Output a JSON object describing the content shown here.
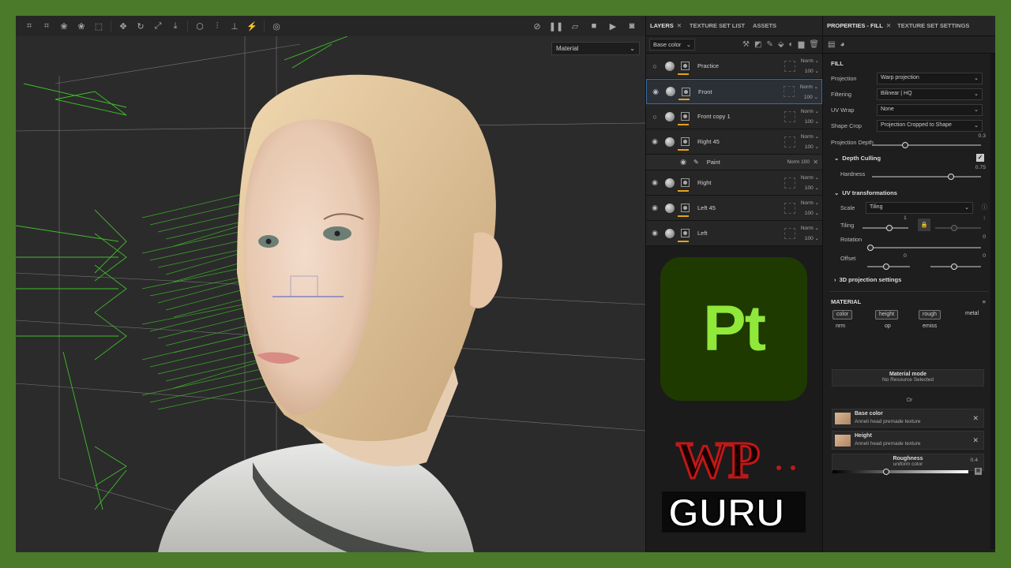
{
  "viewport": {
    "material_select": "Material",
    "toolbar_left": [
      "crop-icon",
      "crop-alt-icon",
      "brush-icon",
      "clone-icon",
      "select-icon",
      "move-icon",
      "rotate-icon",
      "scale-icon",
      "import-icon",
      "cube-icon",
      "mirror-icon",
      "align-icon",
      "magic-icon",
      "camera-reset-icon"
    ],
    "toolbar_right": [
      "hide-icon",
      "pause-icon",
      "view-icon",
      "render-icon",
      "record-icon",
      "screenshot-icon"
    ]
  },
  "layers_panel": {
    "tabs": [
      "LAYERS",
      "TEXTURE SET LIST",
      "ASSETS"
    ],
    "channel": "Base color",
    "layers": [
      {
        "name": "Practice",
        "visible": false,
        "blend": "Norm",
        "opacity": "100"
      },
      {
        "name": "Front",
        "visible": true,
        "blend": "Norm",
        "opacity": "100",
        "selected": true
      },
      {
        "name": "Front copy 1",
        "visible": false,
        "blend": "Norm",
        "opacity": "100"
      },
      {
        "name": "Right 45",
        "visible": true,
        "blend": "Norm",
        "opacity": "100"
      },
      {
        "name": "Paint",
        "visible": true,
        "blend": "Norm",
        "opacity": "100",
        "sub": true
      },
      {
        "name": "Right",
        "visible": true,
        "blend": "Norm",
        "opacity": "100"
      },
      {
        "name": "Left 45",
        "visible": true,
        "blend": "Norm",
        "opacity": "100"
      },
      {
        "name": "Left",
        "visible": true,
        "blend": "Norm",
        "opacity": "100"
      }
    ],
    "logo_text": "Pt",
    "watermark_line1": "WP",
    "watermark_line2": "GURU"
  },
  "properties": {
    "tabs": [
      "PROPERTIES - FILL",
      "TEXTURE SET SETTINGS"
    ],
    "fill_title": "FILL",
    "projection_label": "Projection",
    "projection_value": "Warp projection",
    "filtering_label": "Filtering",
    "filtering_value": "Bilinear | HQ",
    "uvwrap_label": "UV Wrap",
    "uvwrap_value": "None",
    "shapecrop_label": "Shape Crop",
    "shapecrop_value": "Projection Cropped to Shape",
    "depth_label": "Projection Depth",
    "depth_value": "0.3",
    "depth_culling_label": "Depth Culling",
    "hardness_label": "Hardness",
    "hardness_value": "0.75",
    "uv_label": "UV transformations",
    "scale_label": "Scale",
    "scale_value": "Tiling",
    "tiling_label": "Tiling",
    "tiling_value": "1",
    "tiling_value2": "1",
    "rotation_label": "Rotation",
    "rotation_value": "0",
    "offset_label": "Offset",
    "offset_value": "0",
    "offset_value2": "0",
    "proj3d_label": "3D projection settings",
    "material_title": "MATERIAL",
    "channels": [
      "color",
      "height",
      "rough",
      "metal",
      "nrm",
      "op",
      "emiss"
    ],
    "material_mode_label": "Material mode",
    "material_mode_value": "No Resource Selected",
    "or_label": "Or",
    "resources": [
      {
        "title": "Base color",
        "sub": "Anneli head premade texture"
      },
      {
        "title": "Height",
        "sub": "Anneli head premade texture"
      }
    ],
    "roughness_title": "Roughness",
    "roughness_sub": "uniform color",
    "roughness_value": "0.4"
  }
}
